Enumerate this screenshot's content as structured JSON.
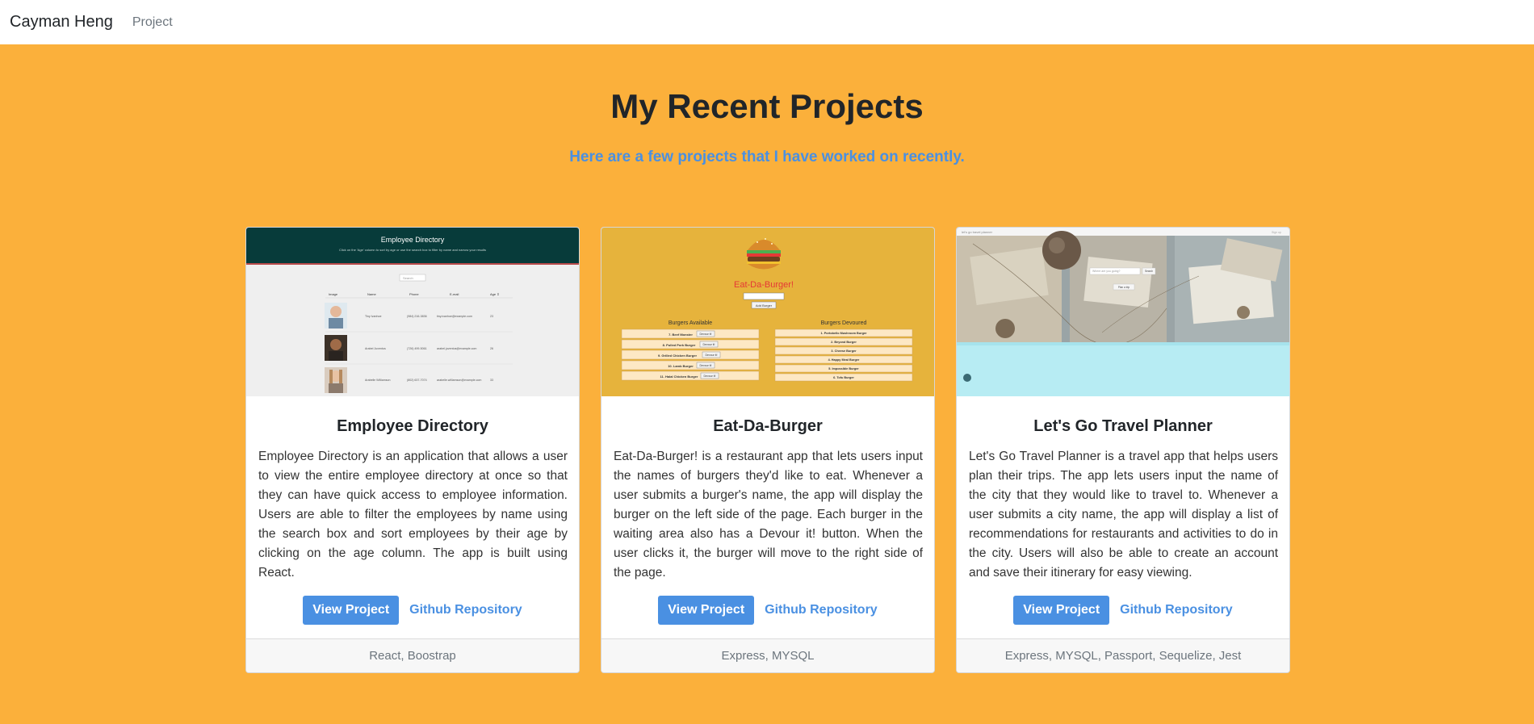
{
  "nav": {
    "brand": "Cayman Heng",
    "link": "Project"
  },
  "hero": {
    "title": "My Recent Projects",
    "subtitle": "Here are a few projects that I have worked on recently."
  },
  "colors": {
    "background": "#fbb03b",
    "accent": "#4a90e2",
    "card": "#ffffff"
  },
  "projects": [
    {
      "title": "Employee Directory",
      "description": "Employee Directory is an application that allows a user to view the entire employee directory at once so that they can have quick access to employee information. Users are able to filter the employees by name using the search box and sort employees by their age by clicking on the age column. The app is built using React.",
      "view_label": "View Project",
      "github_label": "Github Repository",
      "tech": "React, Boostrap",
      "shot": {
        "header": "Employee Directory",
        "sub": "Click on the 'Age' column to sort by age or use the search box to filter by name and narrow your results",
        "search": "Search",
        "cols": [
          "Image",
          "Name",
          "Phone",
          "E-mail",
          "Age ⇕"
        ],
        "rows": [
          [
            "Tiny Ivanhoe",
            "(984) 216-3836",
            "tiny.ivanhoe@example.com",
            "23"
          ],
          [
            "Arabel Juventus",
            "(726) 499-5061",
            "arabel.juventus@example.com",
            "26"
          ],
          [
            "Arabelle Williamson",
            "(802) 637-7074",
            "arabelle.williamson@example.com",
            "33"
          ]
        ]
      }
    },
    {
      "title": "Eat-Da-Burger",
      "description": "Eat-Da-Burger! is a restaurant app that lets users input the names of burgers they'd like to eat. Whenever a user submits a burger's name, the app will display the burger on the left side of the page. Each burger in the waiting area also has a Devour it! button. When the user clicks it, the burger will move to the right side of the page.",
      "view_label": "View Project",
      "github_label": "Github Repository",
      "tech": "Express, MYSQL",
      "shot": {
        "logo": "Eat-Da-Burger!",
        "add_btn": "Add Burger",
        "available_title": "Burgers Available",
        "devoured_title": "Burgers Devoured",
        "devour_btn": "Devour it!",
        "available": [
          "7. Beef Monster",
          "8. Pulled Pork Burger",
          "9. Grilled Chicken Burger",
          "10. Lamb Burger",
          "11. Halal Chicken Burger"
        ],
        "devoured": [
          "1. Portobello Mushroom Burger",
          "2. Beyond Burger",
          "3. Cheese Burger",
          "4. Happy Meal Burger",
          "5. Impossible Burger",
          "6. Tofu Burger"
        ]
      }
    },
    {
      "title": "Let's Go Travel Planner",
      "description": "Let's Go Travel Planner is a travel app that helps users plan their trips. The app lets users input the name of the city that they would like to travel to. Whenever a user submits a city name, the app will display a list of recommendations for restaurants and activities to do in the city. Users will also be able to create an account and save their itinerary for easy viewing.",
      "view_label": "View Project",
      "github_label": "Github Repository",
      "tech": "Express, MYSQL, Passport, Sequelize, Jest",
      "shot": {
        "brand": "let's go travel planner",
        "login": "Sign up",
        "placeholder": "Where are you going?",
        "go_btn": "Search",
        "plan_btn": "Plan a trip"
      }
    }
  ]
}
